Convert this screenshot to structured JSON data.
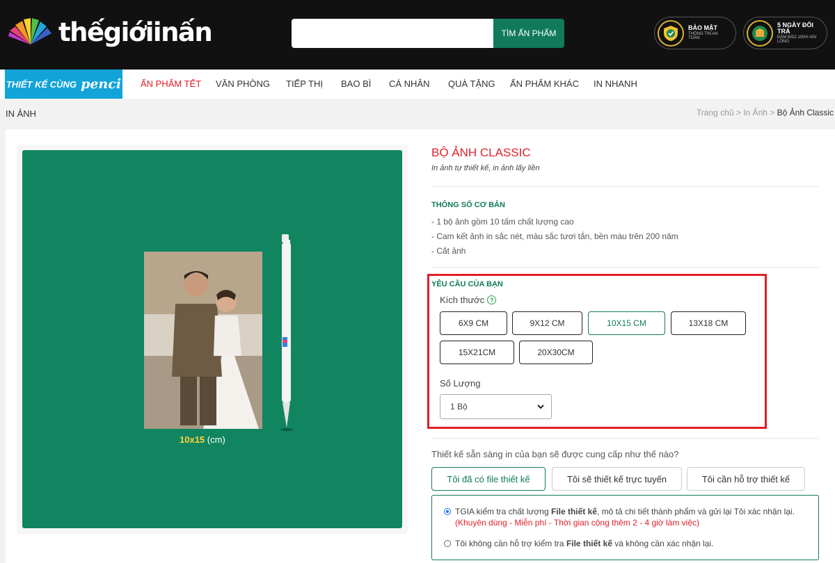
{
  "header": {
    "logo_text": "thếgiớiinấn",
    "search": {
      "value": "",
      "button": "TÌM ẤN PHẨM"
    },
    "badges": [
      {
        "title": "BẢO MẬT",
        "sub": "THÔNG TIN AN TOÀN"
      },
      {
        "title": "5 NGÀY ĐỔI TRẢ",
        "sub": "ĐẢM BẢO 100% HÀI LÒNG"
      }
    ]
  },
  "nav": {
    "brand_a": "THIẾT KẾ CÙNG",
    "brand_b": "penci",
    "items": [
      "ẤN PHẨM TẾT",
      "VĂN PHÒNG",
      "TIẾP THỊ",
      "BAO BÌ",
      "CÁ NHÂN",
      "QUÀ TẶNG",
      "ẤN PHẨM KHÁC",
      "IN NHANH"
    ]
  },
  "breadcrumb": {
    "page_title": "IN ẢNH",
    "items": [
      "Trang chủ",
      "In Ảnh",
      "Bộ Ảnh Classic"
    ],
    "sep": ">"
  },
  "product": {
    "title": "BỘ ẢNH CLASSIC",
    "subtitle": "In ảnh tự thiết kế, in ảnh lấy liền",
    "image_caption_size": "10x15",
    "image_caption_unit": "(cm)",
    "specs_title": "THÔNG SỐ CƠ BẢN",
    "specs": [
      "- 1 bộ ảnh gồm 10 tấm chất lượng cao",
      "- Cam kết ảnh in sắc nét, màu sắc tươi tắn, bền màu trên 200 năm",
      "- Cắt ảnh"
    ]
  },
  "request": {
    "title": "YÊU CẦU CỦA BẠN",
    "size_label": "Kích thước",
    "sizes": [
      "6X9 CM",
      "9X12 CM",
      "10X15 CM",
      "13X18 CM",
      "15X21CM",
      "20X30CM"
    ],
    "selected_size": "10X15 CM",
    "qty_label": "Số Lượng",
    "qty_value": "1 Bộ"
  },
  "supply": {
    "question": "Thiết kế sẵn sàng in của bạn sẽ được cung cấp như thế nào?",
    "tabs": [
      "Tôi đã có file thiết kế",
      "Tôi sẽ thiết kế trực tuyến",
      "Tôi cần hỗ trợ thiết kế"
    ],
    "option1_a": "TGIA kiểm tra chất lượng ",
    "option1_b": "File thiết kế",
    "option1_c": ", mô tả chi tiết thành phẩm và gửi lại Tôi xác nhận lại.",
    "option1_note": "(Khuyên dùng - Miễn phí - Thời gian cộng thêm 2 - 4 giờ làm việc)",
    "option2_a": "Tôi không cần hỗ trợ kiểm tra ",
    "option2_b": "File thiết kế",
    "option2_c": " và không cần xác nhận lại."
  },
  "colors": {
    "brand_green": "#117a5b",
    "accent_red": "#e0202a",
    "highlight": "#e31e24",
    "nav_brand": "#12a4d9"
  }
}
